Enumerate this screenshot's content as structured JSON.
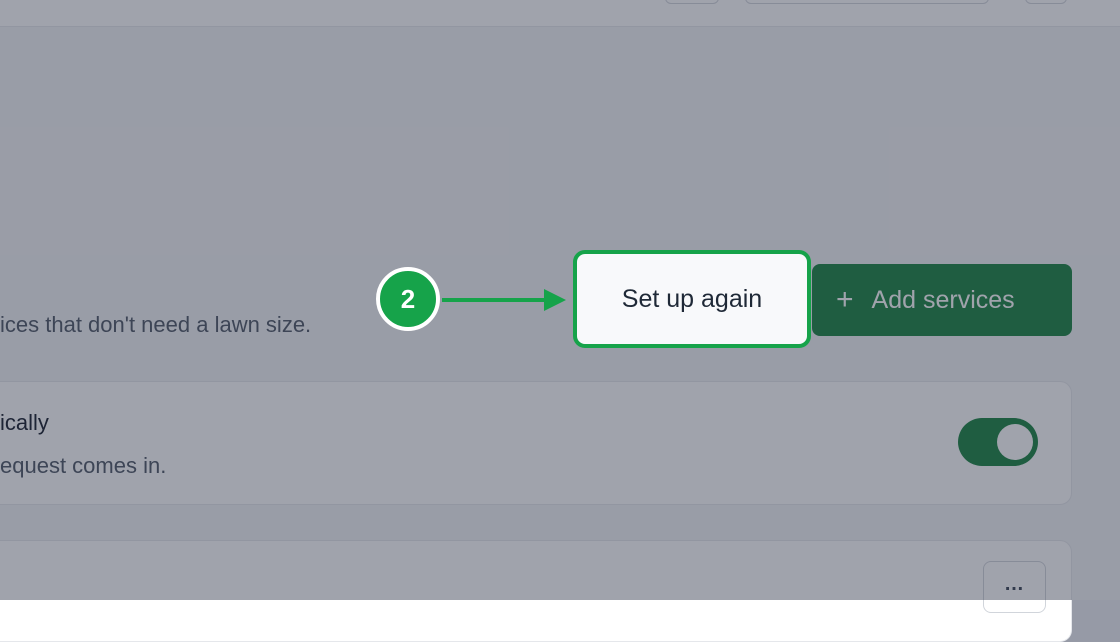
{
  "main": {
    "subtitle": "ices that don't need a lawn size.",
    "add_services_label": "Add services",
    "add_services_icon": "plus-icon"
  },
  "auto_card": {
    "title": "ically",
    "description": "equest comes in.",
    "toggle_state": "on"
  },
  "service_card": {
    "more_label": "…"
  },
  "tutorial": {
    "step_number": "2",
    "target_label": "Set up again",
    "arrow_icon": "arrow-right-icon",
    "accent_color": "#16a34a"
  },
  "colors": {
    "brand": "#15803d",
    "overlay": "rgba(45, 50, 70, 0.45)"
  }
}
